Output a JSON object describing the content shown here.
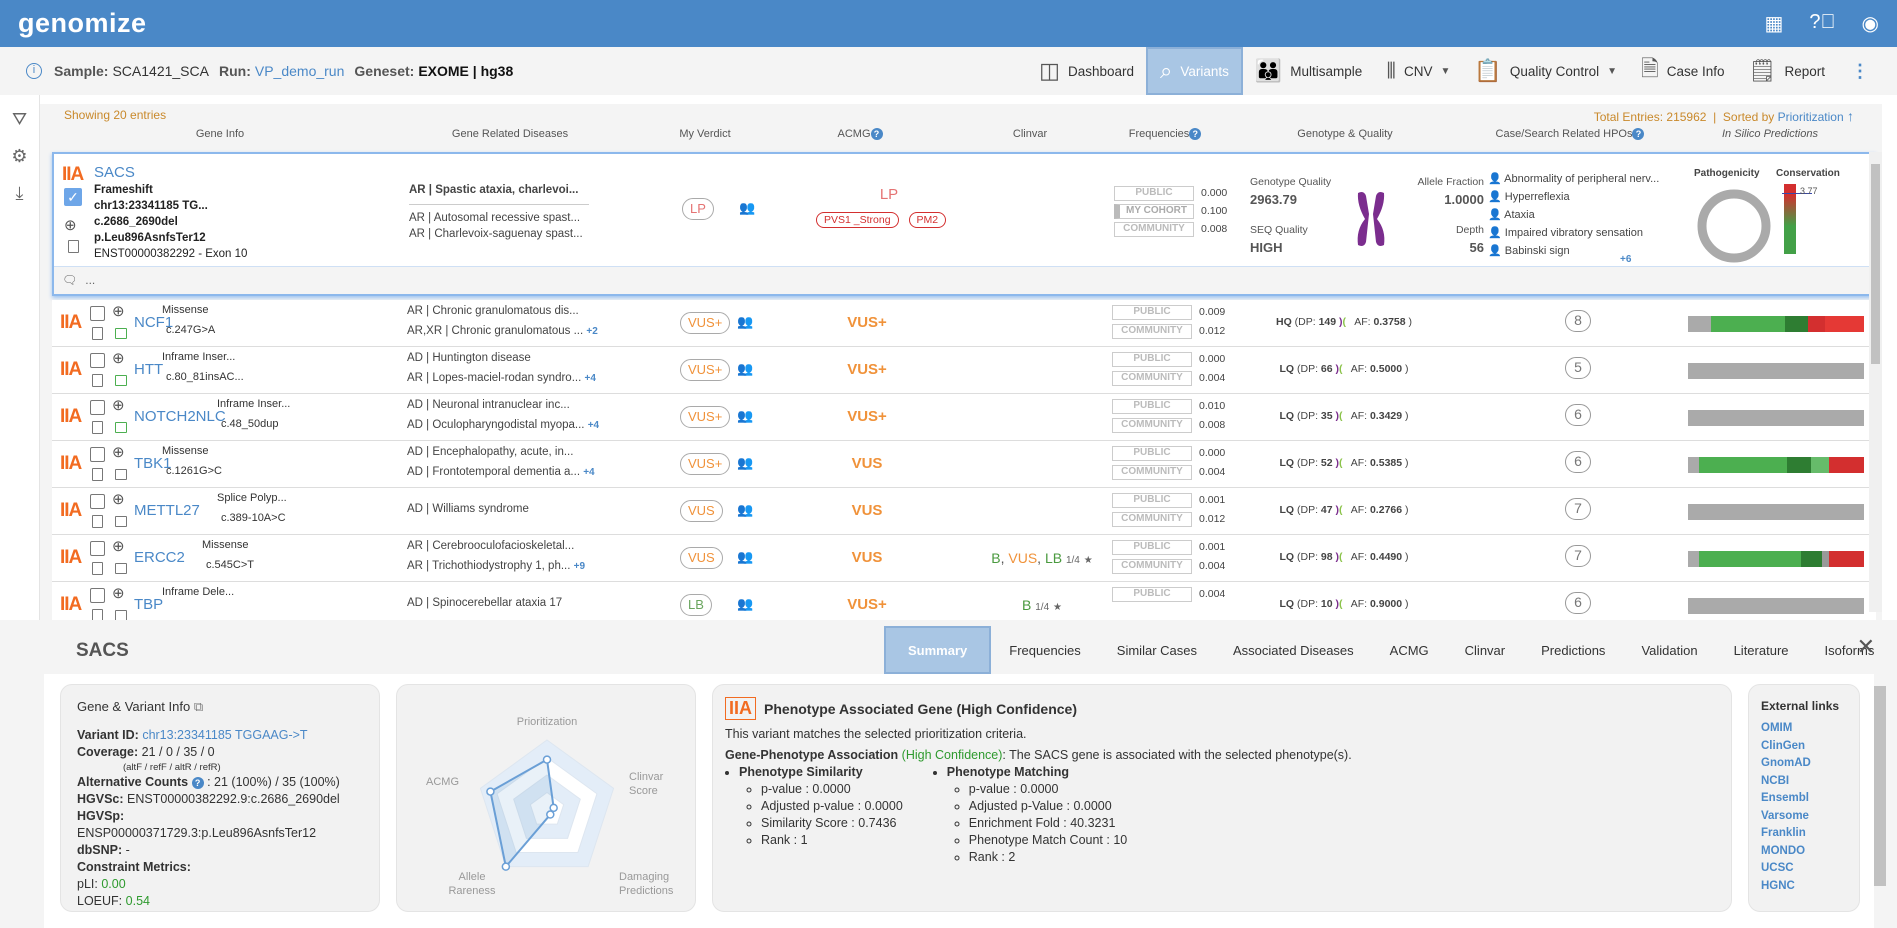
{
  "app": {
    "logo": "genomize",
    "icons": [
      "apps-grid-icon",
      "help-icon",
      "account-icon"
    ]
  },
  "sample": {
    "sample_label": "Sample:",
    "sample": "SCA1421_SCA",
    "run_label": "Run:",
    "run": "VP_demo_run",
    "geneset_label": "Geneset:",
    "geneset": "EXOME | hg38"
  },
  "nav": [
    {
      "label": "Dashboard",
      "icon": "dashboard-icon"
    },
    {
      "label": "Variants",
      "icon": "variants-icon",
      "active": true
    },
    {
      "label": "Multisample",
      "icon": "multisample-icon"
    },
    {
      "label": "CNV",
      "icon": "cnv-icon",
      "dropdown": true
    },
    {
      "label": "Quality Control",
      "icon": "quality-control-icon",
      "dropdown": true
    },
    {
      "label": "Case Info",
      "icon": "case-info-icon"
    },
    {
      "label": "Report",
      "icon": "report-icon"
    }
  ],
  "table": {
    "showing": "Showing 20 entries",
    "total": "Total Entries: 215962",
    "sorted_by_label": "Sorted by",
    "sorted_by": "Prioritization",
    "columns": [
      "Gene Info",
      "Gene Related Diseases",
      "My Verdict",
      "ACMG",
      "Clinvar",
      "Frequencies",
      "Genotype & Quality",
      "Case/Search Related HPOs",
      "In Silico Predictions"
    ]
  },
  "selected": {
    "tier": "IIA",
    "gene": "SACS",
    "type": "Frameshift",
    "pos": "chr13:23341185 TG...",
    "hgvsc": "c.2686_2690del",
    "hgvsp": "p.Leu896AsnfsTer12",
    "transcript": "ENST00000382292 - Exon 10",
    "diseases_main": "AR | Spastic ataxia, charlevoi...",
    "diseases": [
      "AR | Autosomal recessive spast...",
      "AR | Charlevoix-saguenay spast..."
    ],
    "verdict": "LP",
    "acmg": "LP",
    "acmg_criteria": [
      "PVS1 _Strong",
      "PM2"
    ],
    "freq": [
      {
        "label": "PUBLIC",
        "value": "0.000"
      },
      {
        "label": "MY COHORT",
        "value": "0.100"
      },
      {
        "label": "COMMUNITY",
        "value": "0.008"
      }
    ],
    "gq_label": "Genotype Quality",
    "gq": "2963.79",
    "seq_label": "SEQ Quality",
    "seq": "HIGH",
    "af_label": "Allele Fraction",
    "af": "1.0000",
    "depth_label": "Depth",
    "depth": "56",
    "hpos": [
      "Abnormality of peripheral nerv...",
      "Hyperreflexia",
      "Ataxia",
      "Impaired vibratory sensation",
      "Babinski sign"
    ],
    "hpo_more": "+6",
    "pathogenicity_label": "Pathogenicity",
    "conservation_label": "Conservation",
    "conservation": "3.77",
    "comment": "..."
  },
  "rows": [
    {
      "tier": "IIA",
      "gene": "NCF1",
      "type": "Missense",
      "hgvs": "c.247G>A",
      "d1": "AR | Chronic granulomatous dis...",
      "d2": "AR,XR | Chronic granulomatous ...",
      "more": "+2",
      "verdict": "VUS+",
      "acmg": "VUS+",
      "clinvar": "",
      "stars": "",
      "pub": "0.009",
      "com": "0.012",
      "q": "HQ",
      "dp": "149",
      "af": "0.3758",
      "hpo": "8",
      "comment_color": "green",
      "pred": [
        [
          "#aaaaaa",
          0.13
        ],
        [
          "#4caf50",
          0.42
        ],
        [
          "#2e7d32",
          0.13
        ],
        [
          "#d32f2f",
          0.1
        ],
        [
          "#e53935",
          0.22
        ]
      ]
    },
    {
      "tier": "IIA",
      "gene": "HTT",
      "type": "Inframe Inser...",
      "hgvs": "c.80_81insAC...",
      "d1": "AD | Huntington disease",
      "d2": "AR | Lopes-maciel-rodan syndro...",
      "more": "+4",
      "verdict": "VUS+",
      "acmg": "VUS+",
      "clinvar": "",
      "stars": "",
      "pub": "0.000",
      "com": "0.004",
      "q": "LQ",
      "dp": "66",
      "af": "0.5000",
      "hpo": "5",
      "comment_color": "green",
      "pred": [
        [
          "#aaaaaa",
          1
        ]
      ]
    },
    {
      "tier": "IIA",
      "gene": "NOTCH2NLC",
      "type": "Inframe Inser...",
      "hgvs": "c.48_50dup",
      "d1": "AD | Neuronal intranuclear inc...",
      "d2": "AD | Oculopharyngodistal myopa...",
      "more": "+4",
      "verdict": "VUS+",
      "acmg": "VUS+",
      "clinvar": "",
      "stars": "",
      "pub": "0.010",
      "com": "0.008",
      "q": "LQ",
      "dp": "35",
      "af": "0.3429",
      "hpo": "6",
      "comment_color": "green",
      "pred": [
        [
          "#aaaaaa",
          1
        ]
      ]
    },
    {
      "tier": "IIA",
      "gene": "TBK1",
      "type": "Missense",
      "hgvs": "c.1261G>C",
      "d1": "AD | Encephalopathy, acute, in...",
      "d2": "AD | Frontotemporal dementia a...",
      "more": "+4",
      "verdict": "VUS+",
      "acmg": "VUS",
      "clinvar": "",
      "stars": "",
      "pub": "0.000",
      "com": "0.004",
      "q": "LQ",
      "dp": "52",
      "af": "0.5385",
      "hpo": "6",
      "comment_color": "grey",
      "pred": [
        [
          "#aaaaaa",
          0.06
        ],
        [
          "#4caf50",
          0.5
        ],
        [
          "#2e7d32",
          0.14
        ],
        [
          "#66bb6a",
          0.1
        ],
        [
          "#d32f2f",
          0.2
        ]
      ]
    },
    {
      "tier": "IIA",
      "gene": "METTL27",
      "type": "Splice Polyp...",
      "hgvs": "c.389-10A>C",
      "d1": "AD | Williams syndrome",
      "d2": "",
      "more": "",
      "verdict": "VUS",
      "acmg": "VUS",
      "clinvar": "",
      "stars": "",
      "pub": "0.001",
      "com": "0.012",
      "q": "LQ",
      "dp": "47",
      "af": "0.2766",
      "hpo": "7",
      "comment_color": "grey",
      "pred": [
        [
          "#aaaaaa",
          1
        ]
      ]
    },
    {
      "tier": "IIA",
      "gene": "ERCC2",
      "type": "Missense",
      "hgvs": "c.545C>T",
      "d1": "AR | Cerebrooculofacioskeletal...",
      "d2": "AR | Trichothiodystrophy 1, ph...",
      "more": "+9",
      "verdict": "VUS",
      "acmg": "VUS",
      "clinvar": "B, VUS, LB",
      "stars": "1/4",
      "pub": "0.001",
      "com": "0.004",
      "q": "LQ",
      "dp": "98",
      "af": "0.4490",
      "hpo": "7",
      "comment_color": "grey",
      "pred": [
        [
          "#aaaaaa",
          0.06
        ],
        [
          "#4caf50",
          0.58
        ],
        [
          "#2e7d32",
          0.12
        ],
        [
          "#999999",
          0.04
        ],
        [
          "#d32f2f",
          0.2
        ]
      ]
    },
    {
      "tier": "IIA",
      "gene": "TBP",
      "type": "Inframe Dele...",
      "hgvs": "",
      "d1": "AD | Spinocerebellar ataxia 17",
      "d2": "",
      "more": "",
      "verdict": "LB",
      "acmg": "VUS+",
      "clinvar": "B",
      "stars": "1/4",
      "pub": "0.004",
      "com": "",
      "q": "LQ",
      "dp": "10",
      "af": "0.9000",
      "hpo": "6",
      "comment_color": "grey",
      "pred": [
        [
          "#aaaaaa",
          1
        ]
      ]
    }
  ],
  "detail": {
    "gene": "SACS",
    "tabs": [
      "Summary",
      "Frequencies",
      "Similar Cases",
      "Associated Diseases",
      "ACMG",
      "Clinvar",
      "Predictions",
      "Validation",
      "Literature",
      "Isoforms"
    ],
    "info": {
      "title": "Gene & Variant Info",
      "variant_id_label": "Variant ID:",
      "variant_id": "chr13:23341185 TGGAAG->T",
      "coverage_label": "Coverage:",
      "coverage": "21 / 0 / 35 / 0",
      "coverage_note": "(altF / refF / altR / refR)",
      "alt_label": "Alternative Counts",
      "alt": ": 21 (100%) / 35 (100%)",
      "hgvsc_label": "HGVSc:",
      "hgvsc": "ENST00000382292.9:c.2686_2690del",
      "hgvsp_label": "HGVSp:",
      "hgvsp": "ENSP00000371729.3:p.Leu896AsnfsTer12",
      "dbsnp_label": "dbSNP:",
      "dbsnp": "-",
      "constraint_label": "Constraint Metrics:",
      "pli_label": "pLI:",
      "pli": "0.00",
      "loeuf_label": "LOEUF:",
      "loeuf": "0.54"
    },
    "radar": {
      "axes": [
        "Prioritization",
        "Clinvar Score",
        "Damaging Predictions",
        "Allele Rareness",
        "ACMG"
      ],
      "values": [
        0.72,
        0.1,
        0.08,
        1.0,
        0.85
      ]
    },
    "phenotype": {
      "tier": "IIA",
      "title": "Phenotype Associated Gene (High Confidence)",
      "desc": "This variant matches the selected prioritization criteria.",
      "assoc_label": "Gene-Phenotype Association",
      "assoc_conf": "(High Confidence)",
      "assoc_text": ": The SACS gene is associated with the selected phenotype(s).",
      "similarity_title": "Phenotype Similarity",
      "similarity": [
        "p-value : 0.0000",
        "Adjusted p-value : 0.0000",
        "Similarity Score : 0.7436",
        "Rank : 1"
      ],
      "matching_title": "Phenotype Matching",
      "matching": [
        "p-value : 0.0000",
        "Adjusted p-Value : 0.0000",
        "Enrichment Fold : 40.3231",
        "Phenotype Match Count : 10",
        "Rank : 2"
      ]
    },
    "external": {
      "title": "External links",
      "links": [
        "OMIM",
        "ClinGen",
        "GnomAD",
        "NCBI",
        "Ensembl",
        "Varsome",
        "Franklin",
        "MONDO",
        "UCSC",
        "HGNC"
      ]
    }
  },
  "colors": {
    "brand": "#4a88c7",
    "tier": "#f26b21",
    "vus": "#f0923a",
    "lb": "#6aa55e",
    "lp": "#e57373",
    "pathogenic_red": "#d32f2f",
    "chromosome": "#7b2d8e"
  }
}
